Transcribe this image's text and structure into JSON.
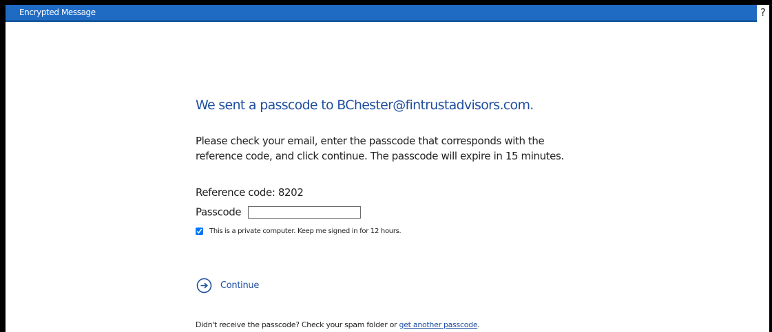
{
  "window": {
    "title": "Encrypted Message",
    "help_label": "?",
    "titlebar_color": "#1f6bc4"
  },
  "main": {
    "heading": "We sent a passcode to BChester@fintrustadvisors.com.",
    "instructions_line1": "Please check your email, enter the passcode that corresponds with the",
    "instructions_line2": "reference code, and click continue. The passcode will expire in 15 minutes.",
    "reference_code": "Reference code: 8202",
    "passcode_label": "Passcode",
    "passcode_value": "",
    "passcode_placeholder": "",
    "keep_signed_in_label": "This is a private computer. Keep me signed in for 12 hours.",
    "keep_signed_in_checked": true,
    "continue_label": "Continue",
    "continue_icon": "arrow-circle-right-icon"
  },
  "footer": {
    "text_before_link": "Didn't receive the passcode? Check your spam folder or ",
    "link_text": "get another passcode",
    "text_after_link": "."
  }
}
